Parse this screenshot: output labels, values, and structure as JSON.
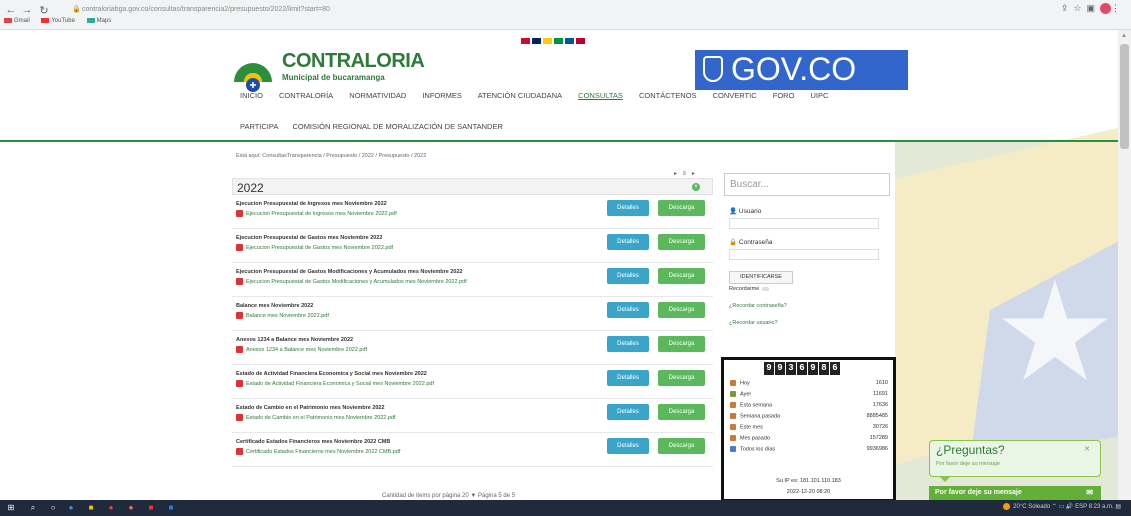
{
  "browser": {
    "url": "contraloriabga.gov.co/consultas/transparencia2/presupuesto/2022/limit?start=80",
    "bookmarks": [
      "Gmail",
      "YouTube",
      "Maps"
    ]
  },
  "header": {
    "logo_title": "CONTRALORIA",
    "logo_subtitle": "Municipal de bucaramanga",
    "gov_label": "GOV.CO",
    "menu": [
      "INICIO",
      "CONTRALORÍA",
      "NORMATIVIDAD",
      "INFORMES",
      "ATENCIÓN CIUDADANA",
      "CONSULTAS",
      "CONTÁCTENOS",
      "CONVERTIC",
      "FORO",
      "UIPC"
    ],
    "menu2": [
      "PARTICIPA",
      "COMISIÓN REGIONAL DE MORALIZACIÓN DE SANTANDER"
    ]
  },
  "breadcrumb": "Está aquí: ConsultasTransparencia / Presupuesto / 2022 / Presupuesto / 2022",
  "tools": "▸ ≡ ▸",
  "folder": {
    "title": "2022",
    "plus": "+"
  },
  "documents": [
    {
      "title": "Ejecucion Presupuestal de Ingresos mes Noviembre 2022",
      "file": "Ejecucion Presupuestal de Ingresos mes Noviembre 2022.pdf",
      "details": "Detalles",
      "download": "Descarga"
    },
    {
      "title": "Ejecucion Presupuestal de Gastos mes Noviembre 2022",
      "file": "Ejecucion Presupuestal de Gastos mes Noviembre 2022.pdf",
      "details": "Detalles",
      "download": "Descarga"
    },
    {
      "title": "Ejecucion Presupuestal de Gastos Modificaciones y Acumulados mes Noviembre 2022",
      "file": "Ejecucion Presupuestal de Gastos Modificaciones y Acumulados mes Noviembre 2022.pdf",
      "details": "Detalles",
      "download": "Descarga"
    },
    {
      "title": "Balance mes Noviembre 2022",
      "file": "Balance mes Noviembre 2022.pdf",
      "details": "Detalles",
      "download": "Descarga"
    },
    {
      "title": "Anexos 1234 a Balance mes Noviembre 2022",
      "file": "Anexos 1234 a Balance mes Noviembre 2022.pdf",
      "details": "Detalles",
      "download": "Descarga"
    },
    {
      "title": "Estado de Actividad Financiera Economica y Social mes Noviembre 2022",
      "file": "Estado de Actividad Financiera Economica y Social mes Noviembre 2022.pdf",
      "details": "Detalles",
      "download": "Descarga"
    },
    {
      "title": "Estado de Cambio en el Patrimonio mes Noviembre 2022",
      "file": "Estado de Cambio en el Patrimonio mes Noviembre 2022.pdf",
      "details": "Detalles",
      "download": "Descarga"
    },
    {
      "title": "Certificado Estados Financieros mes Noviembre 2022 CMB",
      "file": "Certificado Estados Financieros mes Noviembre 2022 CMB.pdf",
      "details": "Detalles",
      "download": "Descarga"
    }
  ],
  "pager": "Cantidad de items por página  20  ▼  Página 5 de 5",
  "search": {
    "placeholder": "Buscar..."
  },
  "login": {
    "user_label": "Usuario",
    "pass_label": "Contraseña",
    "button": "IDENTIFICARSE",
    "remember": "Recordarme",
    "forgot_pass": "¿Recordar contraseña?",
    "forgot_user": "¿Recordar usuario?"
  },
  "counter": {
    "digits": [
      "9",
      "9",
      "3",
      "6",
      "9",
      "8",
      "6"
    ],
    "rows": [
      {
        "label": "Hoy",
        "value": "1610",
        "color": "#c97b3a"
      },
      {
        "label": "Ayer",
        "value": "11691",
        "color": "#7a9a3a"
      },
      {
        "label": "Esta semana",
        "value": "17636",
        "color": "#c97b3a"
      },
      {
        "label": "Semana pasada",
        "value": "8885485",
        "color": "#c97b3a"
      },
      {
        "label": "Este mes",
        "value": "30726",
        "color": "#c97b3a"
      },
      {
        "label": "Mes pasado",
        "value": "157289",
        "color": "#c97b3a"
      },
      {
        "label": "Todos los días",
        "value": "9936986",
        "color": "#4a7ac9"
      }
    ],
    "ip": "Su IP es: 181.101.110.183",
    "date": "2022-12-20 08:20"
  },
  "chat": {
    "title": "¿Preguntas?",
    "subtitle": "Por favor deje su mensaje",
    "bar": "Por favor deje su mensaje"
  },
  "taskbar": {
    "weather": "20°C Soleado",
    "time": "8:23 a.m.",
    "lang": "ESP"
  }
}
